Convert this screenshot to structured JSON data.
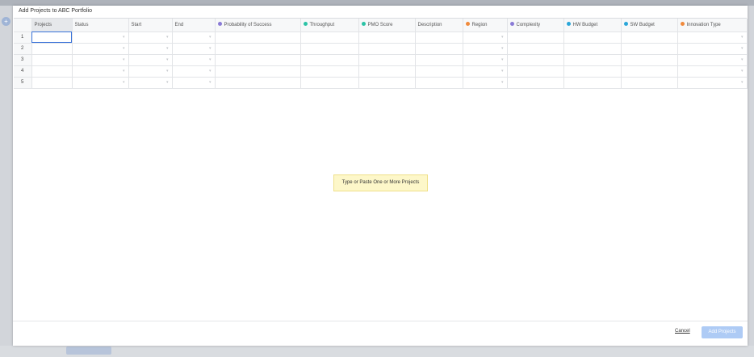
{
  "modal": {
    "title": "Add Projects to ABC Portfolio",
    "hint": "Type or Paste One or More Projects",
    "cancel_label": "Cancel",
    "add_label": "Add Projects"
  },
  "grid": {
    "columns": [
      {
        "label": "Projects",
        "dot": null,
        "dropdown": false
      },
      {
        "label": "Status",
        "dot": null,
        "dropdown": true
      },
      {
        "label": "Start",
        "dot": null,
        "dropdown": true
      },
      {
        "label": "End",
        "dot": null,
        "dropdown": true
      },
      {
        "label": "Probability of Success",
        "dot": "#8a7bd6",
        "dropdown": false
      },
      {
        "label": "Throughput",
        "dot": "#2bc3a6",
        "dropdown": false
      },
      {
        "label": "PMO Score",
        "dot": "#2bc3a6",
        "dropdown": false
      },
      {
        "label": "Description",
        "dot": null,
        "dropdown": false
      },
      {
        "label": "Region",
        "dot": "#f08a3c",
        "dropdown": true
      },
      {
        "label": "Complexity",
        "dot": "#8a7bd6",
        "dropdown": false
      },
      {
        "label": "HW Budget",
        "dot": "#2aa6d9",
        "dropdown": false
      },
      {
        "label": "SW Budget",
        "dot": "#2aa6d9",
        "dropdown": false
      },
      {
        "label": "Innovation Type",
        "dot": "#f08a3c",
        "dropdown": true
      }
    ],
    "rows": [
      "1",
      "2",
      "3",
      "4",
      "5"
    ],
    "selected_accent": "#3a73d9"
  }
}
